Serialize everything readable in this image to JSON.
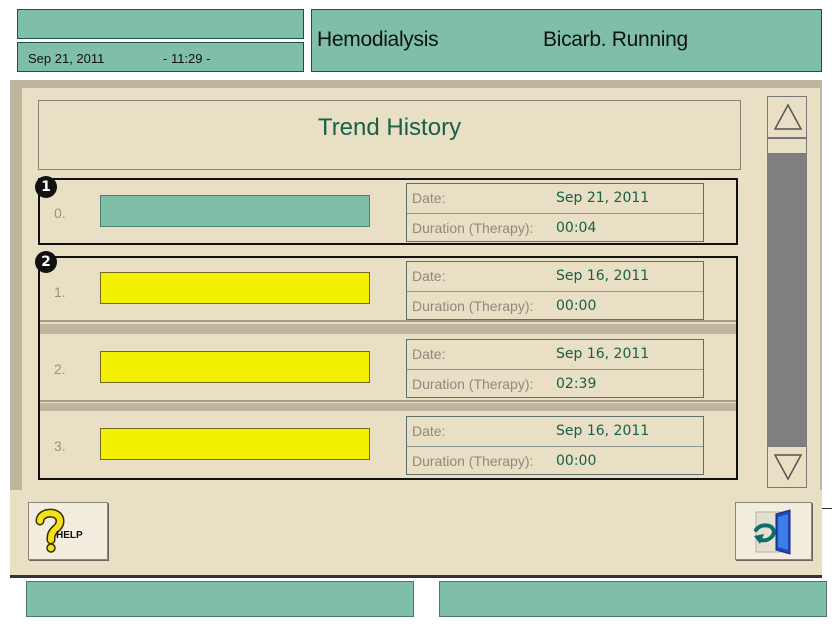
{
  "header": {
    "date": "Sep 21, 2011",
    "time": "- 11:29 -",
    "mode": "Hemodialysis",
    "status": "Bicarb. Running"
  },
  "page": {
    "title": "Trend History"
  },
  "labels": {
    "date": "Date:",
    "duration": "Duration (Therapy):"
  },
  "badges": [
    "1",
    "2"
  ],
  "records": [
    {
      "index": "0.",
      "date": "Sep 21, 2011",
      "duration": "00:04",
      "bar_color": "#7fbfa8"
    },
    {
      "index": "1.",
      "date": "Sep 16, 2011",
      "duration": "00:00",
      "bar_color": "#f4f100"
    },
    {
      "index": "2.",
      "date": "Sep 16, 2011",
      "duration": "02:39",
      "bar_color": "#f4f100"
    },
    {
      "index": "3.",
      "date": "Sep 16, 2011",
      "duration": "00:00",
      "bar_color": "#f4f100"
    }
  ],
  "buttons": {
    "help": "HELP"
  },
  "icons": {
    "scroll_up": "triangle-up-icon",
    "scroll_down": "triangle-down-icon",
    "help": "question-mark-icon",
    "exit": "exit-door-icon"
  },
  "colors": {
    "accent_teal": "#7fbfa8",
    "text_green": "#17604a",
    "highlight_yellow": "#f4f100",
    "panel_beige": "#e9dfc4"
  }
}
